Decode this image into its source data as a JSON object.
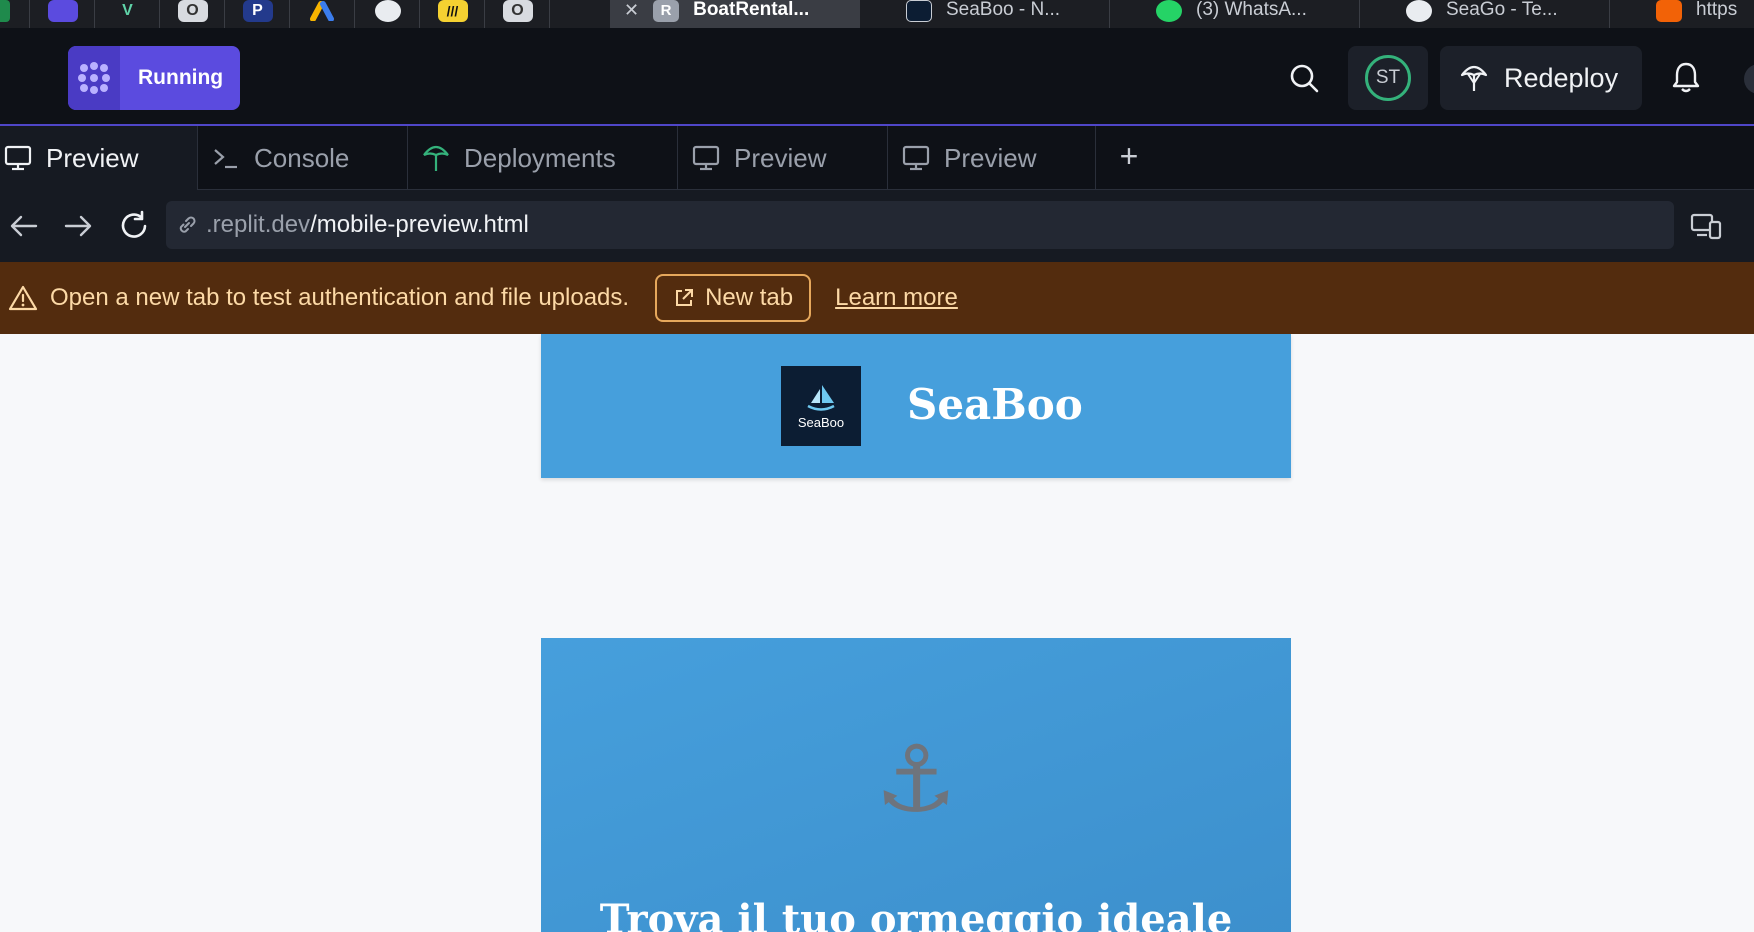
{
  "browser_tabs": {
    "pinned": [
      {
        "icon": "app-icon",
        "color": "#1f8a4c"
      },
      {
        "icon": "kahoot-icon",
        "color": "#5b4bdf"
      },
      {
        "icon": "vercel-v-icon",
        "color": "#1c1e23"
      },
      {
        "icon": "o-app-icon",
        "color": "#d8dbe0"
      },
      {
        "icon": "p-app-icon",
        "color": "#233a8c"
      },
      {
        "icon": "google-ads-icon",
        "color": "#1c1e23"
      },
      {
        "icon": "globe-app-icon",
        "color": "#e9ecf0"
      },
      {
        "icon": "miro-icon",
        "color": "#f5d131"
      },
      {
        "icon": "o-app-icon",
        "color": "#d8dbe0"
      }
    ],
    "tabs": [
      {
        "title": "BoatRental...",
        "icon": "replit-r-icon",
        "active": true
      },
      {
        "title": "SeaBoo - N...",
        "icon": "seaboo-icon",
        "active": false
      },
      {
        "title": "(3) WhatsA...",
        "icon": "whatsapp-icon",
        "active": false
      },
      {
        "title": "SeaGo - Te...",
        "icon": "openai-icon",
        "active": false
      },
      {
        "title": "https",
        "icon": "replit-icon",
        "active": false
      }
    ]
  },
  "header": {
    "run_label": "Running",
    "avatar_initials": "ST",
    "redeploy_label": "Redeploy",
    "accent": "#5b4bdf"
  },
  "workspace_tabs": [
    {
      "label": "Preview",
      "icon": "monitor-icon",
      "active": true
    },
    {
      "label": "Console",
      "icon": "terminal-icon",
      "active": false
    },
    {
      "label": "Deployments",
      "icon": "deploy-icon",
      "active": false
    },
    {
      "label": "Preview",
      "icon": "monitor-icon",
      "active": false
    },
    {
      "label": "Preview",
      "icon": "monitor-icon",
      "active": false
    }
  ],
  "url_bar": {
    "domain": ".replit.dev",
    "path": "/mobile-preview.html"
  },
  "banner": {
    "message": "Open a new tab to test authentication and file uploads.",
    "new_tab_label": "New tab",
    "learn_more_label": "Learn more",
    "color": "#532c0e"
  },
  "site": {
    "logo_text": "SeaBoo",
    "title": "SeaBoo",
    "hero_icon": "⚓",
    "hero_title": "Trova il tuo ormeggio ideale",
    "brand_color": "#469fdc"
  }
}
